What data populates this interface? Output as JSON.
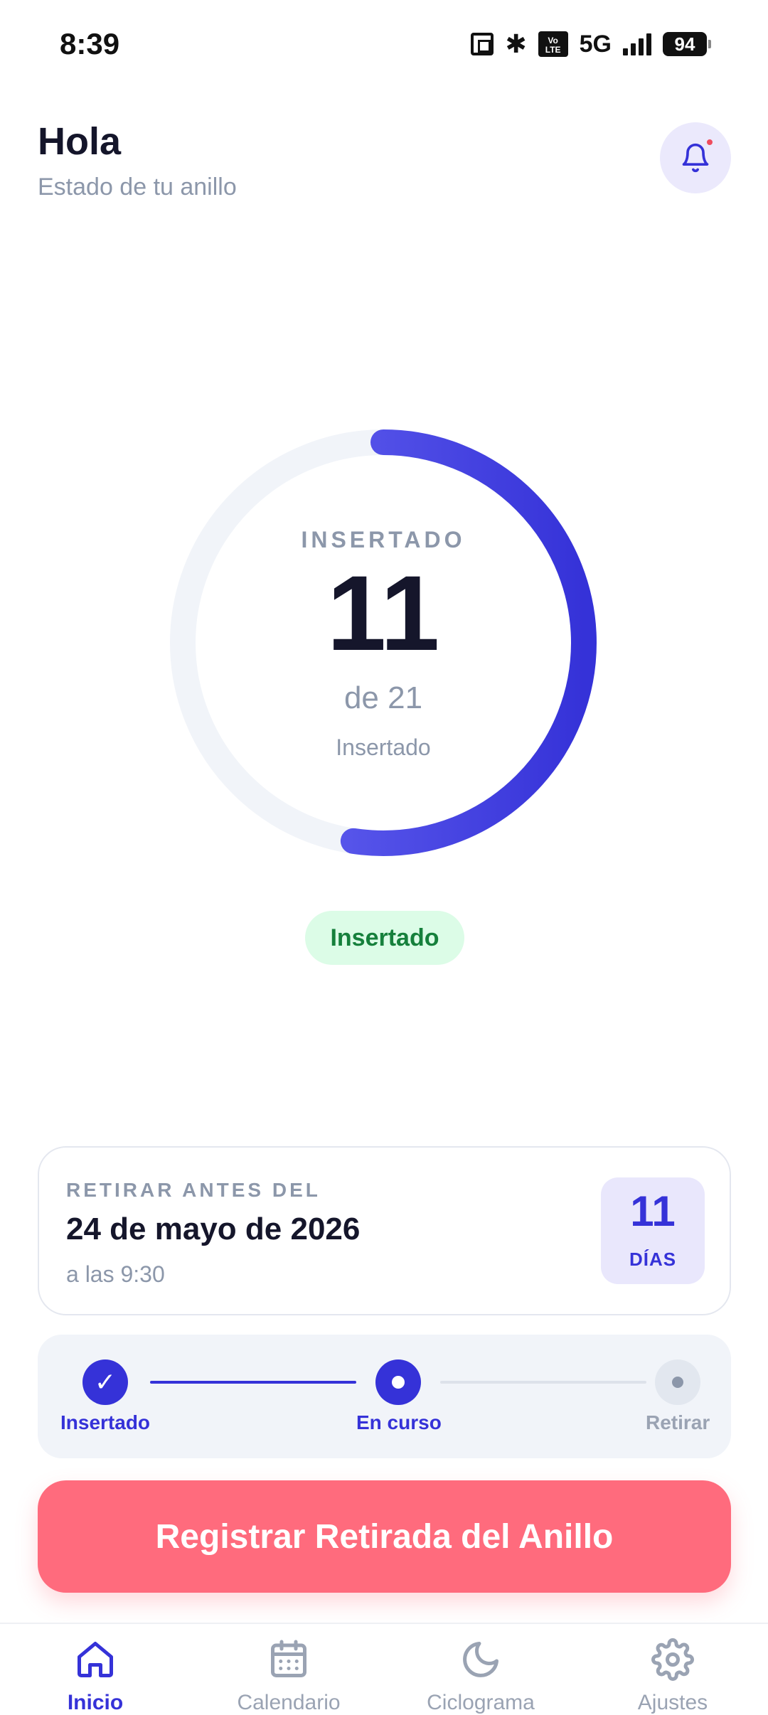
{
  "status_bar": {
    "time": "8:39",
    "network": "5G",
    "battery": "94"
  },
  "header": {
    "greeting": "Hola",
    "subtitle": "Estado de tu anillo"
  },
  "ring": {
    "label": "INSERTADO",
    "value": "11",
    "total_text": "de 21",
    "state": "Insertado",
    "progress_days": 11,
    "total_days": 21
  },
  "status_pill": "Insertado",
  "removal_card": {
    "label": "RETIRAR ANTES DEL",
    "date": "24 de mayo de 2026",
    "time": "a las 9:30",
    "days_value": "11",
    "days_label": "DÍAS"
  },
  "progress": {
    "steps": [
      {
        "label": "Insertado",
        "state": "done"
      },
      {
        "label": "En curso",
        "state": "current"
      },
      {
        "label": "Retirar",
        "state": "todo"
      }
    ]
  },
  "cta": {
    "label": "Registrar Retirada del Anillo"
  },
  "nav": {
    "items": [
      {
        "label": "Inicio",
        "icon": "home-icon",
        "active": true
      },
      {
        "label": "Calendario",
        "icon": "calendar-icon"
      },
      {
        "label": "Ciclograma",
        "icon": "moon-icon"
      },
      {
        "label": "Ajustes",
        "icon": "gear-icon"
      }
    ]
  },
  "colors": {
    "accent": "#3532d8",
    "ring_gradient_start": "#6d6cf6",
    "cta": "#ff6b7d",
    "success_bg": "#dcfce7",
    "success_text": "#16803c"
  }
}
